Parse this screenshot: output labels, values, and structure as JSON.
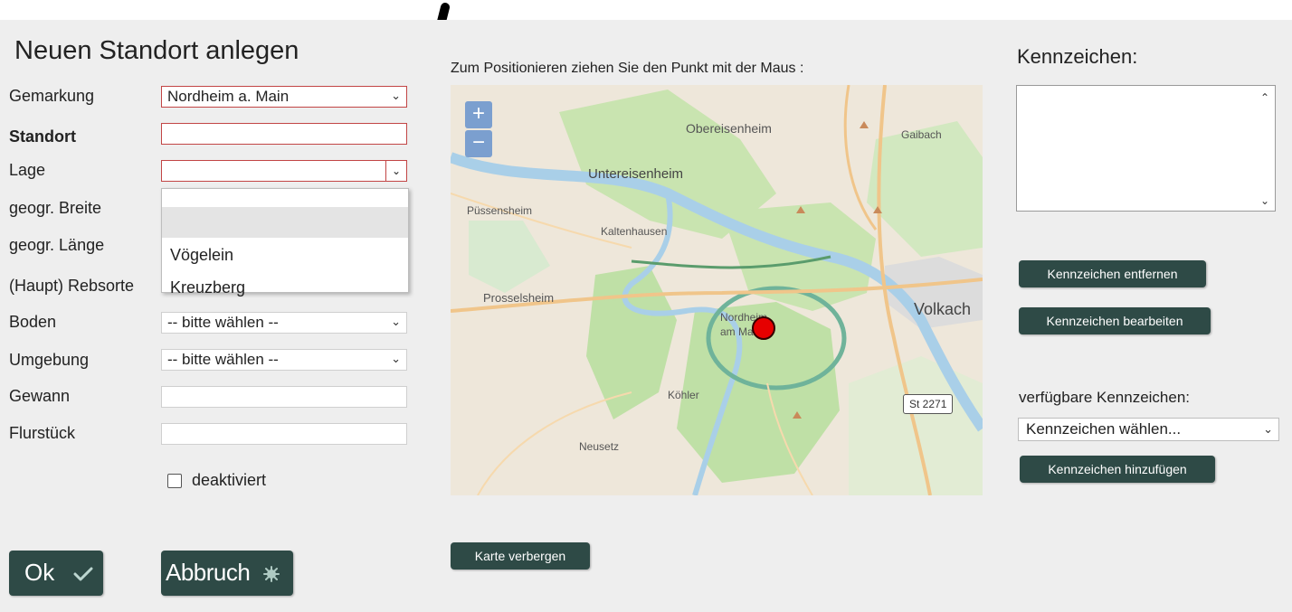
{
  "dialog": {
    "title": "Neuen Standort anlegen",
    "labels": {
      "gemarkung": "Gemarkung",
      "standort": "Standort",
      "lage": "Lage",
      "breite": "geogr. Breite",
      "laenge": "geogr. Länge",
      "rebsorte": "(Haupt) Rebsorte",
      "boden": "Boden",
      "umgebung": "Umgebung",
      "gewann": "Gewann",
      "flurstueck": "Flurstück"
    },
    "values": {
      "gemarkung": "Nordheim a. Main",
      "standort": "",
      "lage": "",
      "boden": "-- bitte wählen --",
      "umgebung": "-- bitte wählen --",
      "gewann": "",
      "flurstueck": ""
    },
    "lage_options": [
      "",
      "Vögelein",
      "Kreuzberg"
    ],
    "deaktiviert_label": "deaktiviert",
    "ok_label": "Ok",
    "abbruch_label": "Abbruch"
  },
  "map": {
    "hint": "Zum Positionieren ziehen Sie den Punkt mit der Maus :",
    "zoom_in": "+",
    "zoom_out": "−",
    "places": {
      "obereisenheim": "Obereisenheim",
      "gaibach": "Gaibach",
      "untereisenheim": "Untereisenheim",
      "puessensheim": "Püssensheim",
      "kaltenhausen": "Kaltenhausen",
      "prosselsheim": "Prosselsheim",
      "volkach": "Volkach",
      "nordheim1": "Nordheim",
      "nordheim2": "am Main",
      "koehler": "Köhler",
      "neusetz": "Neusetz",
      "st2271": "St 2271"
    },
    "hide_button": "Karte verbergen",
    "colors": {
      "forest": "#bfe0a6",
      "river": "#a9cfe8",
      "road": "#f0c58a",
      "marker": "#e60000"
    }
  },
  "kennzeichen": {
    "title": "Kennzeichen:",
    "remove_button": "Kennzeichen entfernen",
    "edit_button": "Kennzeichen bearbeiten",
    "available_label": "verfügbare Kennzeichen:",
    "select_value": "Kennzeichen wählen...",
    "add_button": "Kennzeichen hinzufügen"
  },
  "colors": {
    "button_bg": "#2e4a46",
    "dialog_bg": "#eeeeee",
    "invalid_border": "#c24545",
    "zoom_bg": "#7b9fcf"
  }
}
